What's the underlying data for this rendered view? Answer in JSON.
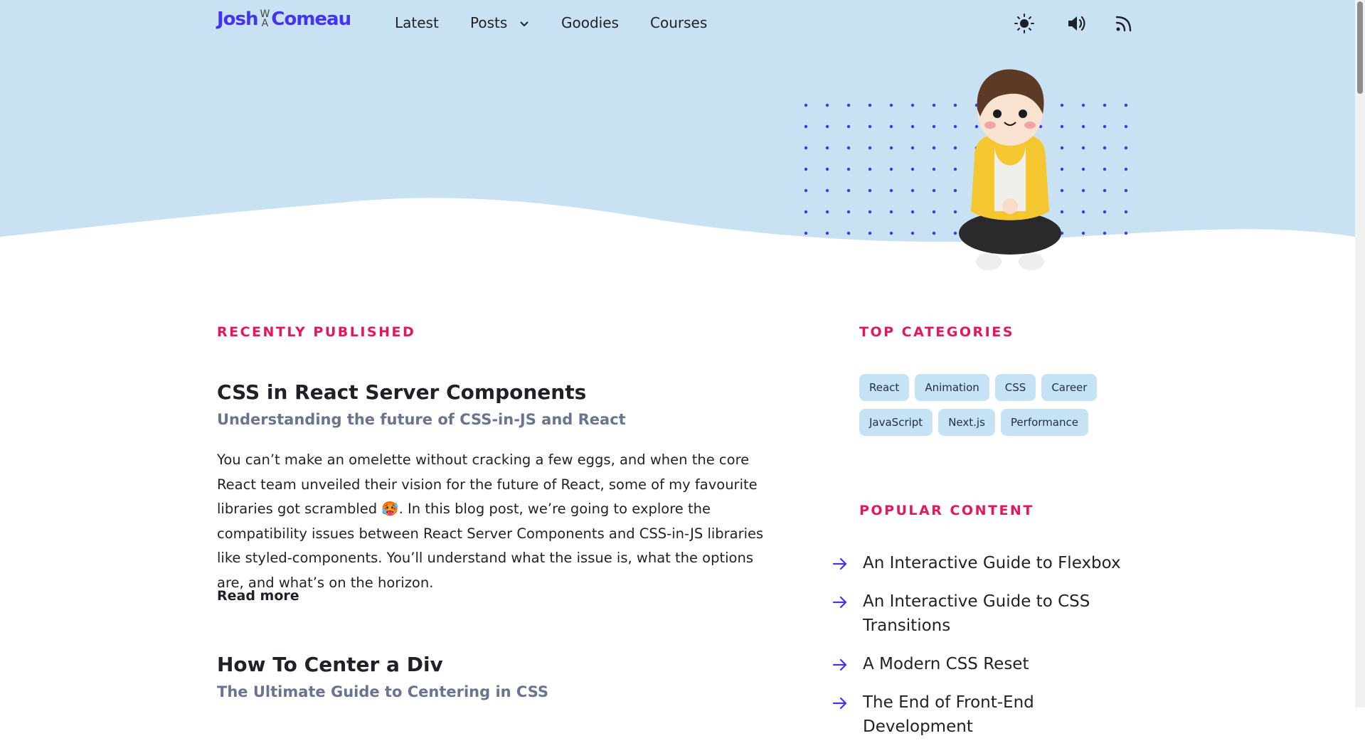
{
  "logo": {
    "first": "Josh",
    "last": "Comeau",
    "w_top": "W",
    "w_bottom": "A"
  },
  "nav": {
    "latest": "Latest",
    "posts": "Posts",
    "goodies": "Goodies",
    "courses": "Courses"
  },
  "icons": {
    "theme": "sun-icon",
    "sound": "volume-icon",
    "rss": "rss-icon",
    "dropdown": "chevron-down-icon",
    "arrow": "arrow-right-icon"
  },
  "colors": {
    "hero_bg": "#c8e2f3",
    "brand": "#4533f2",
    "accent": "#e3165f",
    "tag_bg": "#c6e2f5",
    "subtitle": "#6a7390"
  },
  "recent": {
    "heading": "RECENTLY PUBLISHED",
    "posts": [
      {
        "title": "CSS in React Server Components",
        "subtitle": "Understanding the future of CSS-in-JS and React",
        "body_1": "You can’t make an omelette without cracking a few eggs, and when the core React team unveiled their vision for the future of React, some of my favourite libraries got scrambled ",
        "emoji": "🥵",
        "body_2": ". In this blog post, we’re going to explore the compatibility issues between React Server Components and CSS-in-JS libraries like styled-components. You’ll understand what the issue is, what the options are, and what’s on the horizon.",
        "read_more": "Read more"
      },
      {
        "title": "How To Center a Div",
        "subtitle": "The Ultimate Guide to Centering in CSS"
      }
    ]
  },
  "categories": {
    "heading": "TOP CATEGORIES",
    "tags": [
      "React",
      "Animation",
      "CSS",
      "Career",
      "JavaScript",
      "Next.js",
      "Performance"
    ]
  },
  "popular": {
    "heading": "POPULAR CONTENT",
    "items": [
      "An Interactive Guide to Flexbox",
      "An Interactive Guide to CSS Transitions",
      "A Modern CSS Reset",
      "The End of Front-End Development"
    ]
  }
}
